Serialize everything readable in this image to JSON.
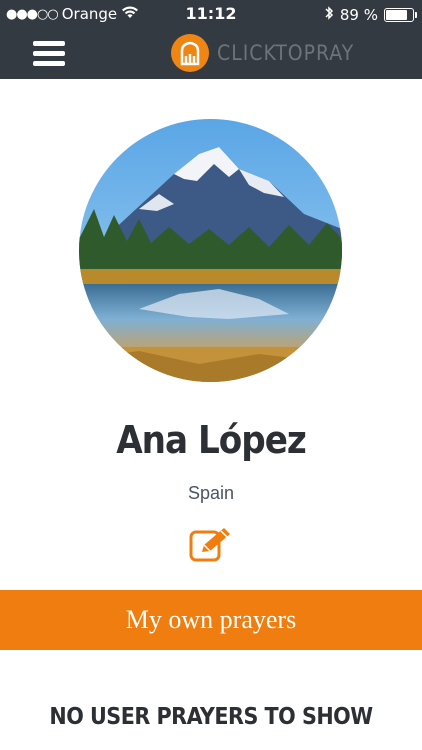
{
  "status_bar": {
    "carrier": "Orange",
    "time": "11:12",
    "battery_percent_text": "89 %",
    "battery_level": 0.89,
    "signal_icon": "signal-dots-icon",
    "wifi_icon": "wifi-icon",
    "bluetooth_icon": "bluetooth-icon"
  },
  "header": {
    "brand_name": "CLICKTOPRAY",
    "menu_icon": "hamburger-menu-icon",
    "logo_icon": "clicktopray-logo-icon",
    "background_color": "#343a42",
    "accent_color": "#ef8614"
  },
  "profile": {
    "name": "Ana López",
    "country": "Spain",
    "avatar_description": "mountain-lake-photo",
    "edit_icon": "edit-icon"
  },
  "prayers": {
    "section_label": "My own prayers",
    "empty_message": "NO USER PRAYERS TO SHOW",
    "accent_color": "#ef7d0f"
  }
}
